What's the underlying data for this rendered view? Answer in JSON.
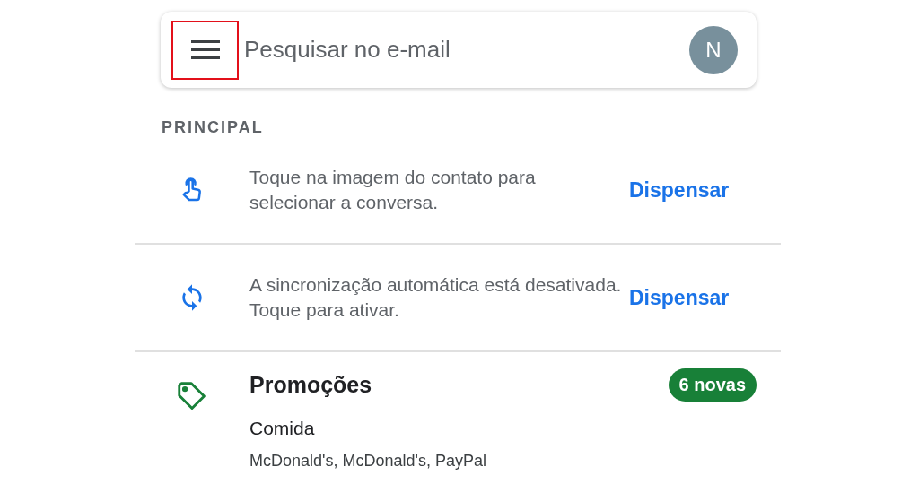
{
  "search": {
    "placeholder": "Pesquisar no e-mail",
    "menu_highlighted": true,
    "avatar": "N"
  },
  "section": "PRINCIPAL",
  "tips": [
    {
      "kind": "touch",
      "text": "Toque na imagem do contato para selecionar a conversa.",
      "action": "Dispensar"
    },
    {
      "kind": "sync",
      "text": "A sincronização automática está desativada. Toque para ativar.",
      "action": "Dispensar"
    }
  ],
  "category": {
    "title": "Promoções",
    "badge": "6 novas",
    "subject": "Comida",
    "senders": "McDonald's, McDonald's, PayPal"
  }
}
